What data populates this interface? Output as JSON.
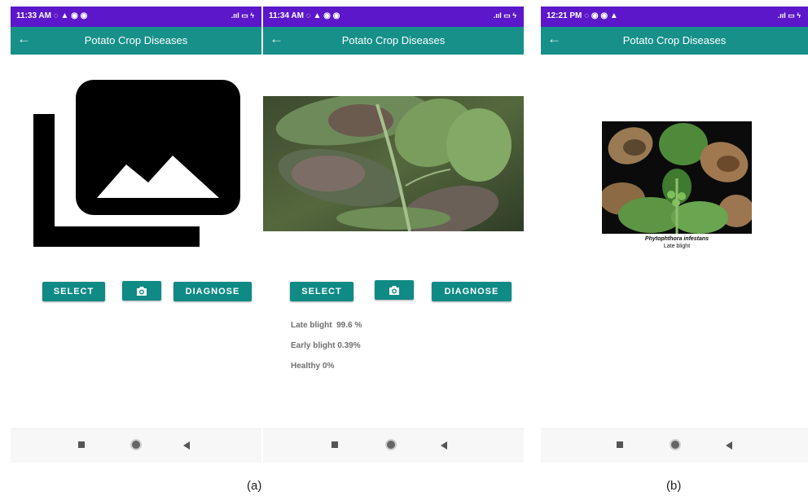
{
  "app": {
    "title": "Potato Crop Diseases",
    "back_icon": "arrow-back-icon",
    "colors": {
      "status_bar": "#5b17c9",
      "app_bar": "#17908a",
      "button": "#0f8a85"
    }
  },
  "screens": [
    {
      "status_time": "11:33 AM",
      "status_icons": "◌ ▲ ◉ ◉",
      "status_system": ".ııl ▭ ϟ",
      "image_placeholder_icon": "photo-library-icon",
      "buttons": {
        "select": "SELECT",
        "camera_icon": "camera-icon",
        "diagnose": "DIAGNOSE"
      }
    },
    {
      "status_time": "11:34 AM",
      "status_icons": "◌ ▲ ◉ ◉",
      "status_system": ".ııl ▭ ϟ",
      "photo": "potato-leaf-photo",
      "buttons": {
        "select": "SELECT",
        "camera_icon": "camera-icon",
        "diagnose": "DIAGNOSE"
      },
      "results": [
        {
          "label": "Late blight",
          "value": "99.6 %"
        },
        {
          "label": "Early blight",
          "value": "0.39%"
        },
        {
          "label": "Healthy",
          "value": "0%"
        }
      ]
    },
    {
      "status_time": "12:21 PM",
      "status_icons": "◌ ◉ ◉ ▲",
      "status_system": ".ııl ▭ ϟ",
      "photo": "late-blight-reference-photo",
      "photo_caption": {
        "species": "Phytophthora infestans",
        "disease": "Late blight"
      }
    }
  ],
  "captions": {
    "left": "(a)",
    "right": "(b)"
  }
}
